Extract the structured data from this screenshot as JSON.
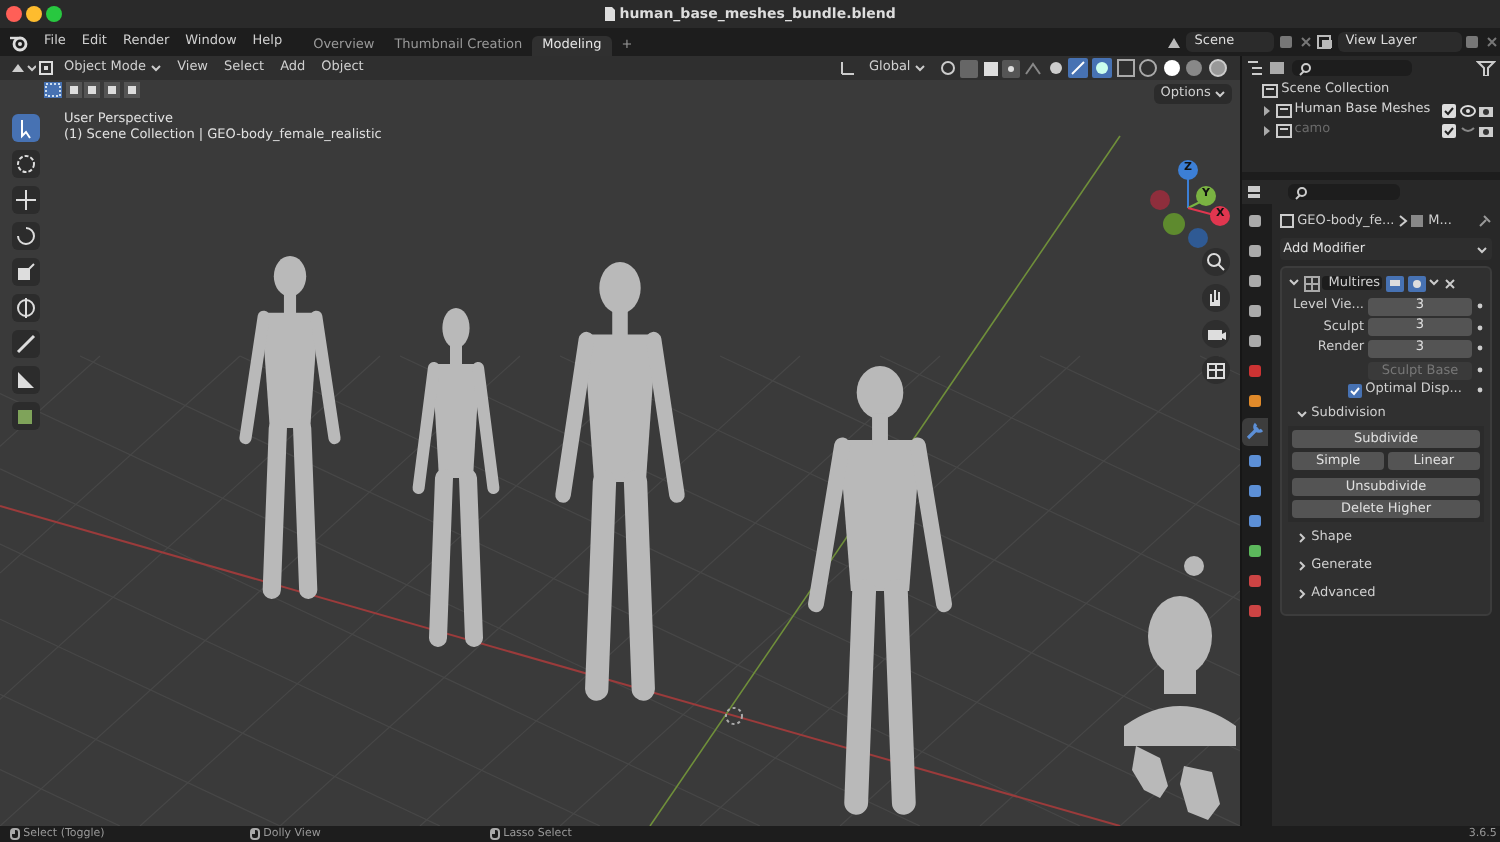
{
  "window": {
    "title": "human_base_meshes_bundle.blend"
  },
  "menu_bar": {
    "items": [
      "File",
      "Edit",
      "Render",
      "Window",
      "Help"
    ]
  },
  "workspace_tabs": [
    {
      "label": "Overview",
      "selected": false
    },
    {
      "label": "Thumbnail Creation",
      "selected": false
    },
    {
      "label": "Modeling",
      "selected": true
    }
  ],
  "add_tab": "+",
  "scene": {
    "name": "Scene"
  },
  "view_layer": {
    "name": "View Layer"
  },
  "viewport": {
    "mode": "Object Mode",
    "menus": [
      "View",
      "Select",
      "Add",
      "Object"
    ],
    "orientation": "Global",
    "options": "Options",
    "view_name": "User Perspective",
    "context": "(1) Scene Collection | GEO-body_female_realistic",
    "gizmo_axes": [
      "Z",
      "Y",
      "X"
    ]
  },
  "outliner": {
    "root": "Scene Collection",
    "children": [
      {
        "label": "Human Base Meshes",
        "dimmed": false,
        "checked": true
      },
      {
        "label": "camo",
        "dimmed": true,
        "checked": true
      }
    ]
  },
  "property_tabs": [
    {
      "selected": false
    },
    {
      "selected": false
    },
    {
      "selected": false
    },
    {
      "selected": false
    },
    {
      "selected": false
    },
    {
      "selected": false
    },
    {
      "selected": false
    },
    {
      "selected": true
    },
    {
      "selected": false
    },
    {
      "selected": false
    },
    {
      "selected": false
    },
    {
      "selected": false
    },
    {
      "selected": false
    },
    {
      "selected": false
    }
  ],
  "properties": {
    "breadcrumb": [
      "GEO-body_fe...",
      "M..."
    ],
    "add_modifier": "Add Modifier",
    "modifier": {
      "name": "Multires",
      "expanded": true,
      "fields": [
        {
          "label": "Level Vie...",
          "value": "3"
        },
        {
          "label": "Sculpt",
          "value": "3"
        },
        {
          "label": "Render",
          "value": "3"
        }
      ],
      "sculpt_base": {
        "label": "Sculpt Base",
        "disabled": true
      },
      "optimal_display": {
        "label": "Optimal Disp...",
        "checked": true
      },
      "subpanels": [
        {
          "label": "Subdivision",
          "expanded": true,
          "buttons": [
            [
              "Subdivide"
            ],
            [
              "Simple",
              "Linear"
            ],
            [
              "Unsubdivide"
            ],
            [
              "Delete Higher"
            ]
          ]
        },
        {
          "label": "Shape",
          "expanded": false
        },
        {
          "label": "Generate",
          "expanded": false
        },
        {
          "label": "Advanced",
          "expanded": false
        }
      ]
    }
  },
  "status_bar": {
    "hints": [
      "Select (Toggle)",
      "Dolly View",
      "Lasso Select"
    ],
    "version": "3.6.5"
  }
}
